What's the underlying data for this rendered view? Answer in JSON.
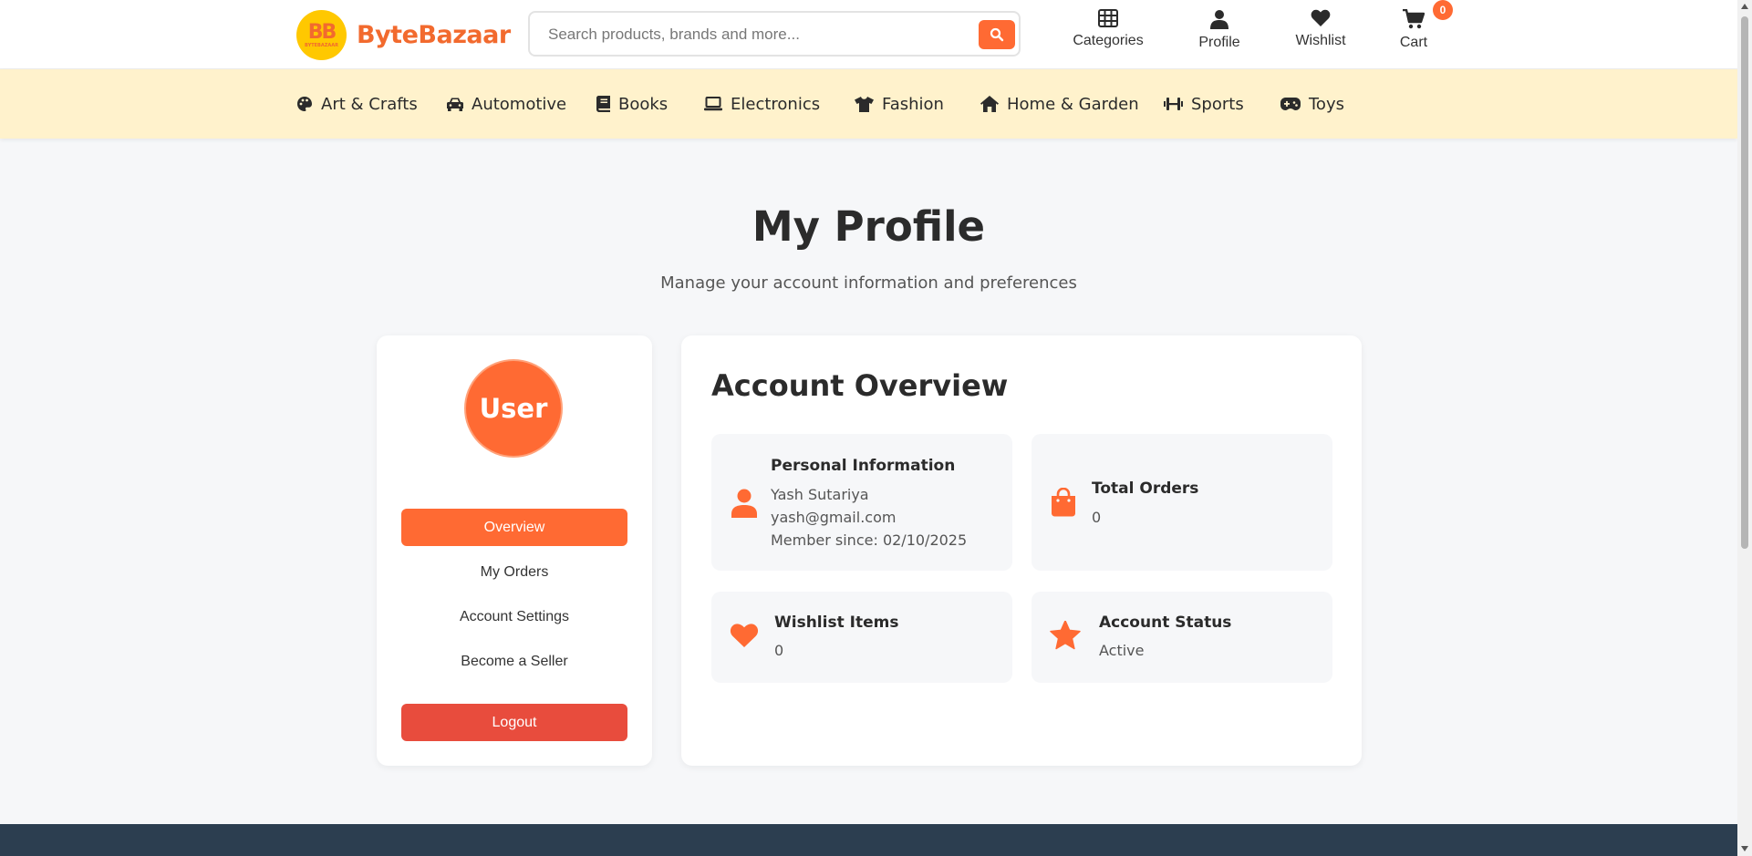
{
  "brand": {
    "logo_text": "BB",
    "logo_subtext": "BYTEBAZAAR",
    "name": "ByteBazaar",
    "accent_color": "#ff6a33"
  },
  "search": {
    "placeholder": "Search products, brands and more...",
    "icon": "search-icon"
  },
  "header_actions": [
    {
      "label": "Categories",
      "icon": "grid-icon"
    },
    {
      "label": "Profile",
      "icon": "user-icon"
    },
    {
      "label": "Wishlist",
      "icon": "heart-icon"
    },
    {
      "label": "Cart",
      "icon": "cart-icon",
      "badge": "0"
    }
  ],
  "categories": [
    {
      "label": "Art & Crafts",
      "icon": "palette-icon"
    },
    {
      "label": "Automotive",
      "icon": "car-icon"
    },
    {
      "label": "Books",
      "icon": "book-icon"
    },
    {
      "label": "Electronics",
      "icon": "laptop-icon"
    },
    {
      "label": "Fashion",
      "icon": "shirt-icon"
    },
    {
      "label": "Home & Garden",
      "icon": "home-icon"
    },
    {
      "label": "Sports",
      "icon": "dumbbell-icon"
    },
    {
      "label": "Toys",
      "icon": "gamepad-icon"
    }
  ],
  "page": {
    "title": "My Profile",
    "subtitle": "Manage your account information and preferences"
  },
  "sidebar": {
    "avatar_text": "User",
    "items": [
      {
        "label": "Overview",
        "active": true
      },
      {
        "label": "My Orders",
        "active": false
      },
      {
        "label": "Account Settings",
        "active": false
      },
      {
        "label": "Become a Seller",
        "active": false
      }
    ],
    "logout_label": "Logout"
  },
  "overview": {
    "title": "Account Overview",
    "personal": {
      "title": "Personal Information",
      "name": "Yash Sutariya",
      "email": "yash@gmail.com",
      "member_since": "Member since: 02/10/2025",
      "icon": "user-icon"
    },
    "orders": {
      "title": "Total Orders",
      "value": "0",
      "icon": "shopping-bag-icon"
    },
    "wishlist": {
      "title": "Wishlist Items",
      "value": "0",
      "icon": "heart-icon"
    },
    "status": {
      "title": "Account Status",
      "value": "Active",
      "icon": "star-icon"
    }
  }
}
